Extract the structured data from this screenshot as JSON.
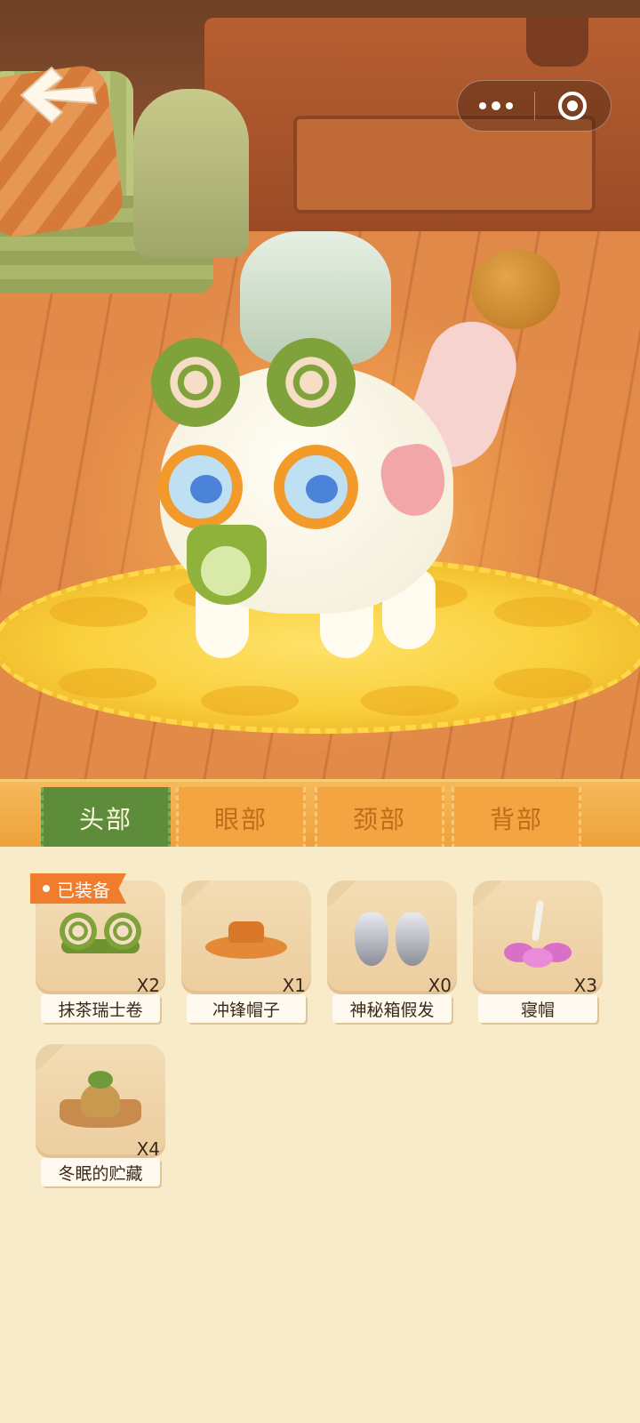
{
  "nav": {
    "back_icon": "back-arrow-icon",
    "capsule": {
      "more_icon": "more-dots-icon",
      "close_icon": "target-circle-icon"
    }
  },
  "tabs": [
    {
      "label": "头部",
      "active": true
    },
    {
      "label": "眼部",
      "active": false
    },
    {
      "label": "颈部",
      "active": false
    },
    {
      "label": "背部",
      "active": false
    }
  ],
  "items": [
    {
      "name": "抹茶瑞士卷",
      "count": "X2",
      "equipped_label": "已装备"
    },
    {
      "name": "冲锋帽子",
      "count": "X1"
    },
    {
      "name": "神秘箱假发",
      "count": "X0"
    },
    {
      "name": "寝帽",
      "count": "X3"
    },
    {
      "name": "冬眠的贮藏",
      "count": "X4"
    }
  ],
  "colors": {
    "active_tab": "#5d8d3a",
    "inactive_tab": "#f2a540",
    "equipped_badge": "#ef7d2b",
    "panel_bg": "#f8ebc9"
  }
}
